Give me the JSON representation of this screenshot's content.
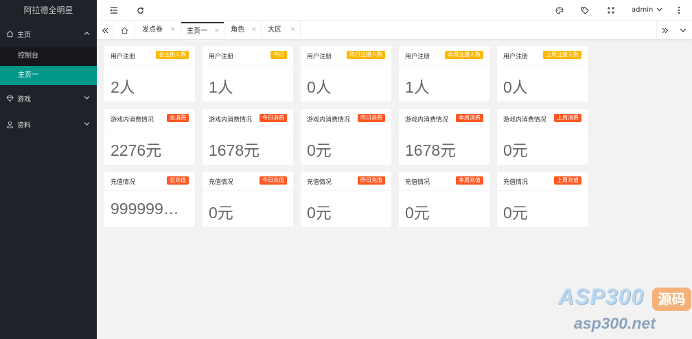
{
  "app": {
    "title": "阿拉德全明星"
  },
  "sidebar": {
    "groups": [
      {
        "label": "主页",
        "icon": "home-icon",
        "items": [
          {
            "label": "控制台"
          },
          {
            "label": "主页一"
          }
        ]
      },
      {
        "label": "游戏",
        "icon": "diamond-icon"
      },
      {
        "label": "资料",
        "icon": "user-icon"
      }
    ]
  },
  "header": {
    "user": "admin"
  },
  "tabs": [
    {
      "label": "发点卷"
    },
    {
      "label": "主页一"
    },
    {
      "label": "角色"
    },
    {
      "label": "大区"
    }
  ],
  "cards": [
    {
      "title": "用户注册",
      "badge": "总注册人数",
      "value": "2人"
    },
    {
      "title": "用户注册",
      "badge": "今日",
      "value": "1人"
    },
    {
      "title": "用户注册",
      "badge": "昨日注册人数",
      "value": "0人"
    },
    {
      "title": "用户注册",
      "badge": "本周注册人数",
      "value": "1人"
    },
    {
      "title": "用户注册",
      "badge": "上周注册人数",
      "value": "0人"
    },
    {
      "title": "游戏内消费情况",
      "badge": "总消费",
      "value": "2276元"
    },
    {
      "title": "游戏内消费情况",
      "badge": "今日消费",
      "value": "1678元"
    },
    {
      "title": "游戏内消费情况",
      "badge": "昨日消费",
      "value": "0元"
    },
    {
      "title": "游戏内消费情况",
      "badge": "本周消费",
      "value": "1678元"
    },
    {
      "title": "游戏内消费情况",
      "badge": "上周消费",
      "value": "0元"
    },
    {
      "title": "充值情况",
      "badge": "总充值",
      "value": "999999…"
    },
    {
      "title": "充值情况",
      "badge": "今日充值",
      "value": "0元"
    },
    {
      "title": "充值情况",
      "badge": "昨日充值",
      "value": "0元"
    },
    {
      "title": "充值情况",
      "badge": "本周充值",
      "value": "0元"
    },
    {
      "title": "充值情况",
      "badge": "上周充值",
      "value": "0元"
    }
  ],
  "colors": {
    "sidebar": "#20222a",
    "accent": "#009688",
    "badge_yellow": "#ffb800",
    "badge_orange": "#ff5722"
  },
  "watermark": {
    "brand": "ASP300",
    "tag": "源码",
    "url": "asp300.net"
  }
}
